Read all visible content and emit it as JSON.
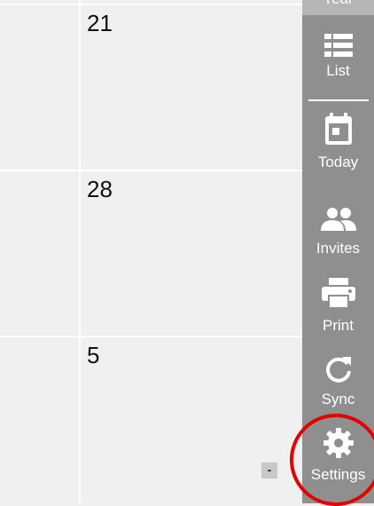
{
  "calendar": {
    "rows": [
      {
        "date": "21"
      },
      {
        "date": "28"
      },
      {
        "date": "5"
      }
    ],
    "collapse_label": "-"
  },
  "sidebar": {
    "top_partial_label": "Year",
    "buttons": [
      {
        "label": "List",
        "icon": "list-icon"
      },
      {
        "label": "Today",
        "icon": "calendar-today-icon"
      },
      {
        "label": "Invites",
        "icon": "people-icon"
      },
      {
        "label": "Print",
        "icon": "printer-icon"
      },
      {
        "label": "Sync",
        "icon": "refresh-icon"
      },
      {
        "label": "Settings",
        "icon": "gear-icon"
      }
    ]
  },
  "colors": {
    "sidebar_bg": "#8f8f8f",
    "calendar_bg": "#f0f0f0",
    "highlight": "#e40000"
  }
}
